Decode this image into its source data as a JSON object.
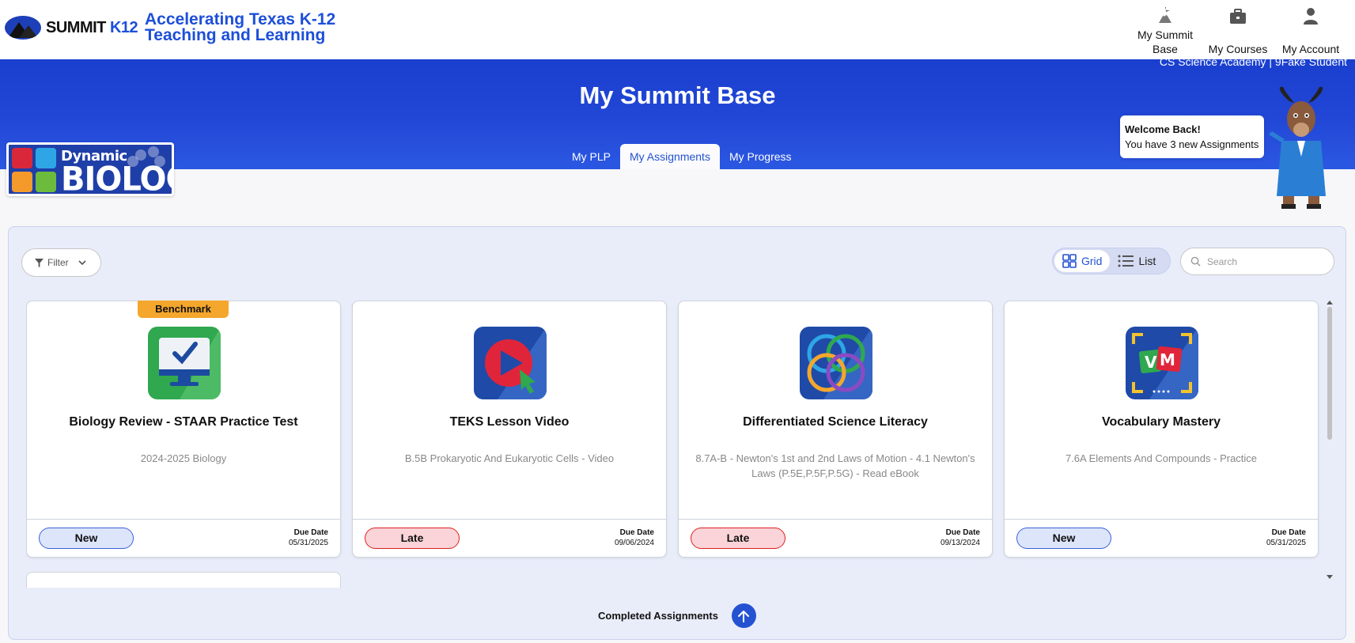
{
  "brand": {
    "name_main": "SUMMIT",
    "name_accent": "K12",
    "tagline_line1": "Accelerating Texas K-12",
    "tagline_line2": "Teaching and Learning"
  },
  "top_nav": [
    {
      "label_line1": "My Summit",
      "label_line2": "Base",
      "icon": "mountain-icon"
    },
    {
      "label_line1": "My Courses",
      "label_line2": "",
      "icon": "briefcase-icon"
    },
    {
      "label_line1": "My Account",
      "label_line2": "",
      "icon": "user-icon"
    }
  ],
  "banner": {
    "school_user": "CS Science Academy | 9Fake Student",
    "title": "My Summit Base",
    "tabs": [
      {
        "label": "My PLP",
        "active": false
      },
      {
        "label": "My Assignments",
        "active": true
      },
      {
        "label": "My Progress",
        "active": false
      }
    ]
  },
  "course_logo": {
    "word1": "Dynamic",
    "word2": "BIOLOGY"
  },
  "welcome": {
    "heading": "Welcome Back!",
    "message": "You have 3 new Assignments"
  },
  "toolbar": {
    "filter_label": "Filter",
    "grid_label": "Grid",
    "list_label": "List",
    "search_placeholder": "Search"
  },
  "cards": [
    {
      "ribbon": "Benchmark",
      "icon": "monitor-check-icon",
      "title": "Biology Review - STAAR Practice Test",
      "subtitle": "2024-2025 Biology",
      "status": "New",
      "due_label": "Due Date",
      "due_date": "05/31/2025"
    },
    {
      "ribbon": "",
      "icon": "video-play-icon",
      "title": "TEKS Lesson Video",
      "subtitle": "B.5B Prokaryotic And Eukaryotic Cells - Video",
      "status": "Late",
      "due_label": "Due Date",
      "due_date": "09/06/2024"
    },
    {
      "ribbon": "",
      "icon": "interlocking-rings-icon",
      "title": "Differentiated Science Literacy",
      "subtitle": "8.7A-B - Newton's 1st and 2nd Laws of Motion - 4.1 Newton's Laws (P.5E,P.5F,P.5G) - Read eBook",
      "status": "Late",
      "due_label": "Due Date",
      "due_date": "09/13/2024"
    },
    {
      "ribbon": "",
      "icon": "vocabulary-vm-icon",
      "title": "Vocabulary Mastery",
      "subtitle": "7.6A Elements And Compounds - Practice",
      "status": "New",
      "due_label": "Due Date",
      "due_date": "05/31/2025"
    }
  ],
  "completed": {
    "label": "Completed Assignments"
  },
  "colors": {
    "accent": "#2452d1",
    "banner": "#1a3fcf",
    "benchmark": "#f4a72c",
    "late": "#d22222",
    "new": "#3b63d7"
  }
}
